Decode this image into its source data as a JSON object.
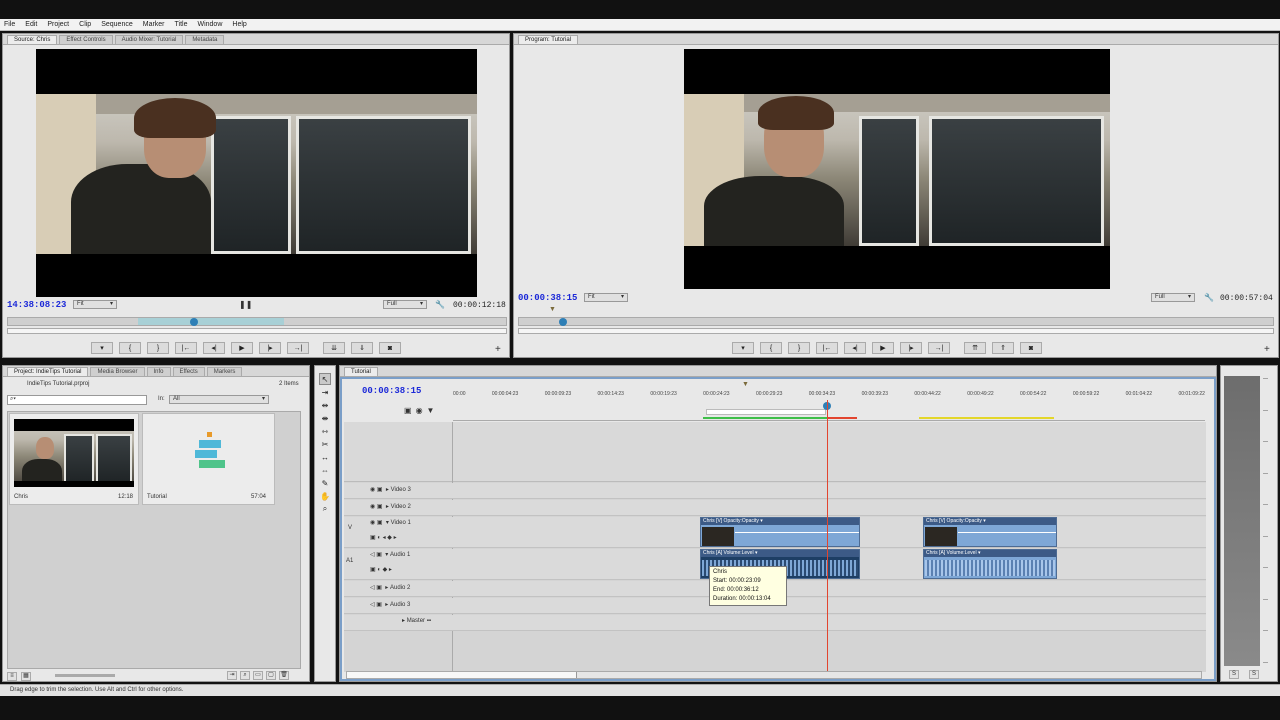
{
  "menu": [
    "File",
    "Edit",
    "Project",
    "Clip",
    "Sequence",
    "Marker",
    "Title",
    "Window",
    "Help"
  ],
  "source_panel": {
    "tabs": [
      "Source: Chris",
      "Effect Controls",
      "Audio Mixer: Tutorial",
      "Metadata"
    ],
    "timecode_left": "14:38:08:23",
    "fit_label": "Fit",
    "full_label": "Full",
    "timecode_right": "00:00:12:18"
  },
  "program_panel": {
    "tabs": [
      "Program: Tutorial"
    ],
    "timecode_left": "00:00:38:15",
    "fit_label": "Fit",
    "full_label": "Full",
    "timecode_right": "00:00:57:04"
  },
  "project_panel": {
    "tabs": [
      "Project: IndieTips Tutorial",
      "Media Browser",
      "Info",
      "Effects",
      "Markers"
    ],
    "project_file": "IndieTips Tutorial.prproj",
    "item_count": "2 Items",
    "in_label": "In:",
    "in_value": "All",
    "items": [
      {
        "name": "Chris",
        "duration": "12:18"
      },
      {
        "name": "Tutorial",
        "duration": "57:04"
      }
    ]
  },
  "timeline": {
    "tab": "Tutorial",
    "timecode": "00:00:38:15",
    "ruler": [
      "00:00",
      "00:00:04:23",
      "00:00:09:23",
      "00:00:14:23",
      "00:00:19:23",
      "00:00:24:23",
      "00:00:29:23",
      "00:00:34:23",
      "00:00:39:23",
      "00:00:44:22",
      "00:00:49:22",
      "00:00:54:22",
      "00:00:59:22",
      "00:01:04:22",
      "00:01:09:22"
    ],
    "tracks": [
      {
        "label": "Video 3"
      },
      {
        "label": "Video 2"
      },
      {
        "label": "Video 1",
        "side": "V"
      },
      {
        "label": "Audio 1",
        "side": "A1"
      },
      {
        "label": "Audio 2"
      },
      {
        "label": "Audio 3"
      },
      {
        "label": "Master"
      }
    ],
    "clips": {
      "video_a": "Chris [V]  Opacity:Opacity ▾",
      "audio_a": "Chris [A]  Volume:Level ▾",
      "video_b": "Chris [V]  Opacity:Opacity ▾",
      "audio_b": "Chris [A]  Volume:Level ▾"
    },
    "tooltip": {
      "name": "Chris",
      "start": "Start: 00:00:23:09",
      "end": "End: 00:00:36:12",
      "duration": "Duration: 00:00:13:04"
    }
  },
  "status_bar": "Drag edge to trim the selection. Use Alt and Ctrl for other options.",
  "colors": {
    "timecode_blue": "#1d2ad8",
    "clip_blue": "#7ea7d6",
    "playhead": "#e2452f",
    "workarea_green": "#3fbf4a",
    "workarea_yellow": "#e3d62a"
  }
}
